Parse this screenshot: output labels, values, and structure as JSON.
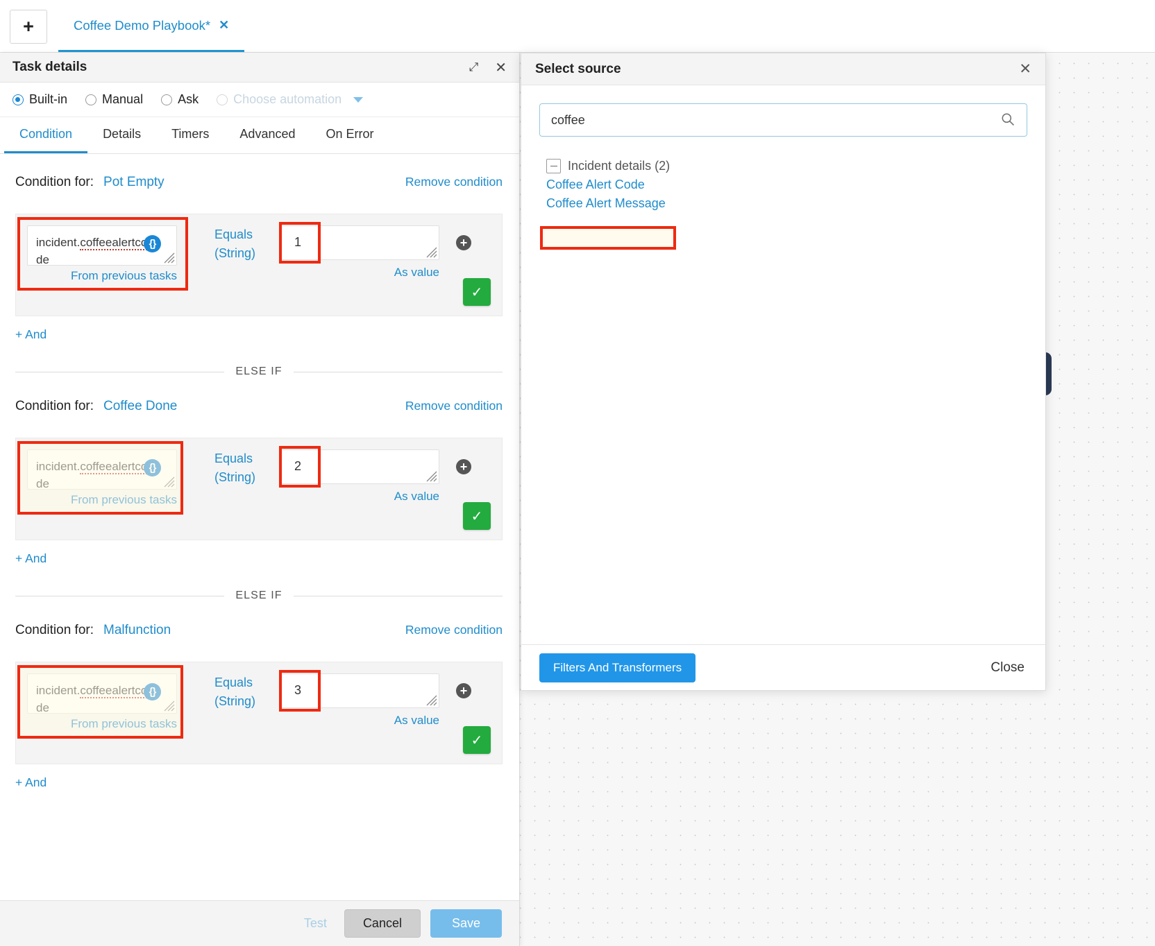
{
  "tabbar": {
    "new_tab_icon": "plus-icon",
    "active_tab": {
      "label": "Coffee Demo Playbook*",
      "close_icon": "✕"
    }
  },
  "task_panel": {
    "header": {
      "title": "Task details",
      "expand_icon": "⤢",
      "close_icon": "✕"
    },
    "modes": [
      {
        "label": "Built-in",
        "checked": true,
        "disabled": false
      },
      {
        "label": "Manual",
        "checked": false,
        "disabled": false
      },
      {
        "label": "Ask",
        "checked": false,
        "disabled": false
      },
      {
        "label": "Choose automation",
        "checked": false,
        "disabled": true
      }
    ],
    "tabs": [
      {
        "label": "Condition",
        "active": true
      },
      {
        "label": "Details",
        "active": false
      },
      {
        "label": "Timers",
        "active": false
      },
      {
        "label": "Advanced",
        "active": false
      },
      {
        "label": "On Error",
        "active": false
      }
    ],
    "condition_label": "Condition for:",
    "remove_condition": "Remove condition",
    "else_if": "ELSE IF",
    "and_link": "+ And",
    "as_value": "As value",
    "from_previous_tasks": "From previous tasks",
    "operator": "Equals",
    "operator_type": "(String)",
    "source_expression": "incident.coffeealertcode",
    "source_expression_prefix": "incident.",
    "source_expression_misspelled": "coffeealertcode",
    "brace_icon": "{}",
    "add_icon": "+",
    "confirm_icon": "✓",
    "conditions": [
      {
        "name": "Pot Empty",
        "value": "1"
      },
      {
        "name": "Coffee Done",
        "value": "2"
      },
      {
        "name": "Malfunction",
        "value": "3"
      }
    ],
    "footer": {
      "test_label": "Test",
      "cancel_label": "Cancel",
      "save_label": "Save"
    }
  },
  "select_source_dialog": {
    "title": "Select source",
    "close_icon": "✕",
    "search": {
      "value": "coffee",
      "placeholder": "",
      "icon": "search-icon"
    },
    "group": {
      "label": "Incident details (2)",
      "collapse_icon": "minus-box-icon"
    },
    "items": [
      {
        "label": "Coffee Alert Code",
        "highlighted": true
      },
      {
        "label": "Coffee Alert Message",
        "highlighted": false
      }
    ],
    "footer": {
      "filters_label": "Filters And Transformers",
      "close_label": "Close"
    }
  },
  "colors": {
    "accent_blue": "#1f8ccc",
    "primary_blue": "#2196e8",
    "highlight_red": "#ee2a11",
    "success_green": "#24ab3f",
    "save_blue": "#76bdec"
  }
}
